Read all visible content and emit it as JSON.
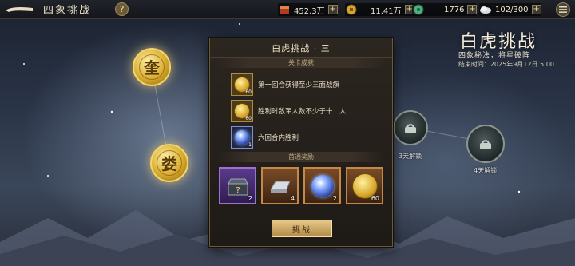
{
  "header": {
    "title": "四象挑战",
    "help_label": "?",
    "resources": [
      {
        "icon": "treasure-icon",
        "value": "452.3万"
      },
      {
        "icon": "copper-coin-icon",
        "value": "11.41万"
      },
      {
        "icon": "jade-icon",
        "value": "1776"
      },
      {
        "icon": "stamina-icon",
        "value": "102/300"
      }
    ],
    "plus_label": "+"
  },
  "nodes": {
    "gold": [
      {
        "label": "奎"
      },
      {
        "label": "娄"
      }
    ],
    "locked": [
      {
        "label": "3天解锁"
      },
      {
        "label": "4天解锁"
      }
    ]
  },
  "event": {
    "title": "白虎挑战",
    "subtitle": "四象秘法，将星破阵",
    "end_time": "结束时间：2025年9月12日 5:00"
  },
  "panel": {
    "title": "白虎挑战 · 三",
    "achievements_header": "关卡成就",
    "achievements": [
      {
        "text": "第一回合获得至少三面战旗",
        "count": "60",
        "icon": "gold-coin-icon"
      },
      {
        "text": "胜利时敌军人数不少于十二人",
        "count": "60",
        "icon": "gold-coin-icon"
      },
      {
        "text": "六回合内胜利",
        "count": "1",
        "icon": "blue-orb-icon"
      }
    ],
    "rewards_header": "首通奖励",
    "rewards": [
      {
        "icon": "mystery-chest-icon",
        "count": "2",
        "rarity": "purple"
      },
      {
        "icon": "silver-ingot-icon",
        "count": "4",
        "rarity": "orange"
      },
      {
        "icon": "blue-orb-icon",
        "count": "2",
        "rarity": "orange"
      },
      {
        "icon": "gold-coin-icon",
        "count": "60",
        "rarity": "orange"
      }
    ],
    "challenge_label": "挑战"
  },
  "colors": {
    "accent_gold": "#d9ab2e",
    "panel_bg": "#2c2620",
    "purple_frame": "#9a72d4",
    "orange_frame": "#c58846"
  }
}
